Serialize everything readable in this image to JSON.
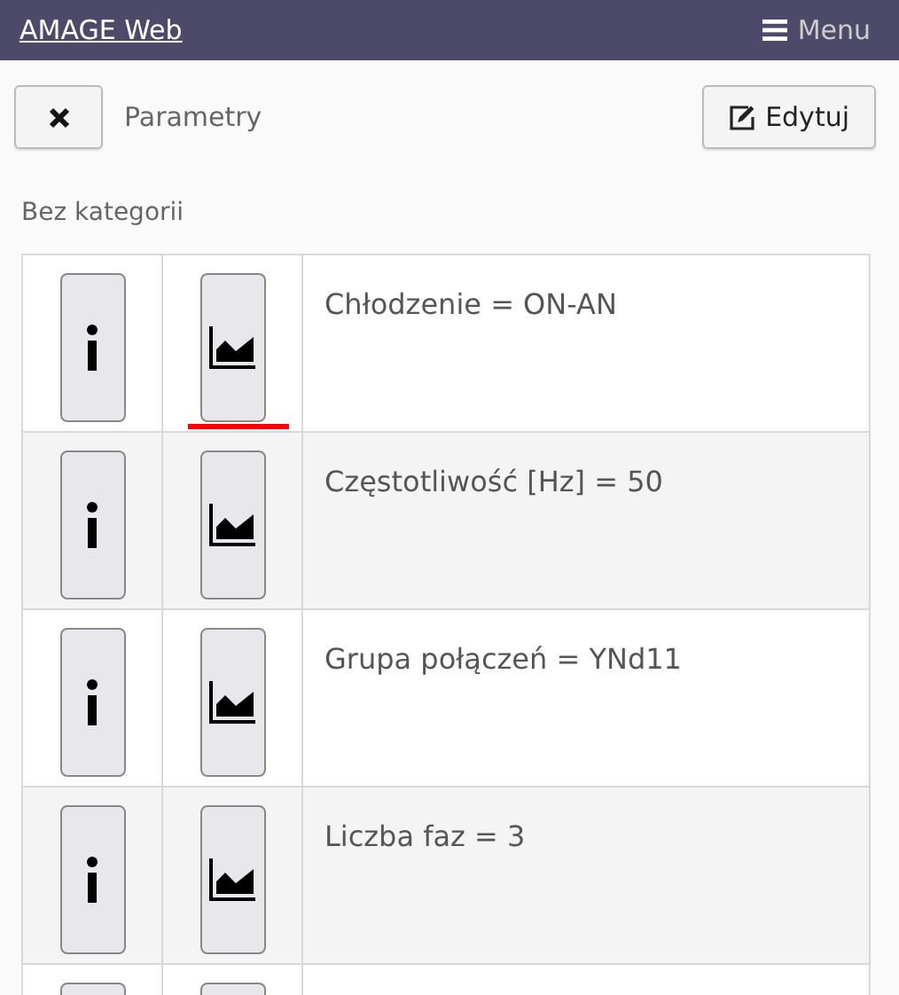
{
  "navbar": {
    "brand": "AMAGE Web",
    "menu_label": "Menu"
  },
  "toolbar": {
    "title": "Parametry",
    "edit_label": "Edytuj"
  },
  "category": "Bez kategorii",
  "rows": [
    {
      "text": "Chłodzenie = ON-AN",
      "underlined": true
    },
    {
      "text": "Częstotliwość [Hz] = 50",
      "underlined": false
    },
    {
      "text": "Grupa połączeń = YNd11",
      "underlined": false
    },
    {
      "text": "Liczba faz = 3",
      "underlined": false
    },
    {}
  ]
}
